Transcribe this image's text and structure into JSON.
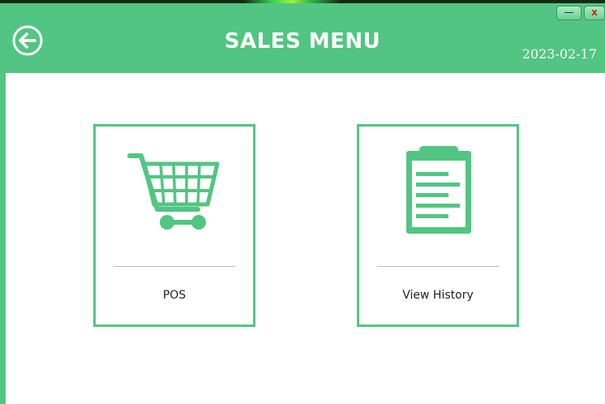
{
  "header": {
    "title": "SALES MENU",
    "date": "2023-02-17",
    "accent_color": "#52c582",
    "back_icon": "arrow-left-circle-icon"
  },
  "window_controls": {
    "minimize_label": "—",
    "close_label": "x"
  },
  "menu": {
    "items": [
      {
        "label": "POS",
        "icon": "shopping-cart-icon"
      },
      {
        "label": "View History",
        "icon": "clipboard-list-icon"
      }
    ]
  }
}
